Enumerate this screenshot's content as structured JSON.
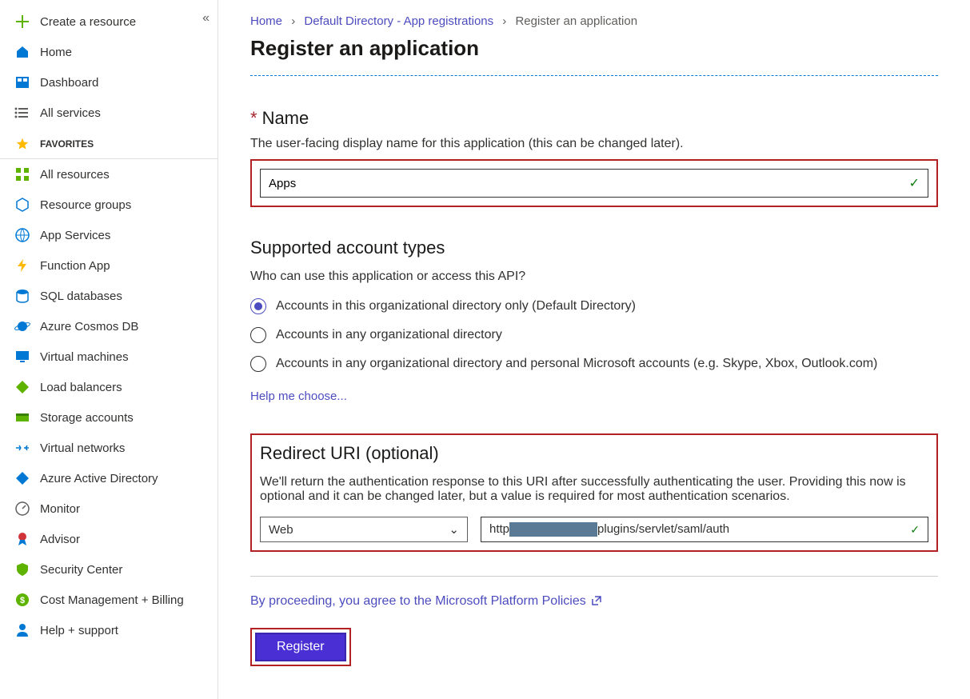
{
  "sidebar": {
    "create": "Create a resource",
    "home": "Home",
    "dashboard": "Dashboard",
    "all_services": "All services",
    "favorites_label": "FAVORITES",
    "items": [
      "All resources",
      "Resource groups",
      "App Services",
      "Function App",
      "SQL databases",
      "Azure Cosmos DB",
      "Virtual machines",
      "Load balancers",
      "Storage accounts",
      "Virtual networks",
      "Azure Active Directory",
      "Monitor",
      "Advisor",
      "Security Center",
      "Cost Management + Billing",
      "Help + support"
    ]
  },
  "breadcrumbs": {
    "home": "Home",
    "dir": "Default Directory - App registrations",
    "current": "Register an application"
  },
  "page_title": "Register an application",
  "name": {
    "label": "Name",
    "desc": "The user-facing display name for this application (this can be changed later).",
    "value": "Apps"
  },
  "account_types": {
    "title": "Supported account types",
    "desc": "Who can use this application or access this API?",
    "options": [
      "Accounts in this organizational directory only (Default Directory)",
      "Accounts in any organizational directory",
      "Accounts in any organizational directory and personal Microsoft accounts (e.g. Skype, Xbox, Outlook.com)"
    ],
    "help": "Help me choose..."
  },
  "redirect": {
    "title": "Redirect URI (optional)",
    "desc": "We'll return the authentication response to this URI after successfully authenticating the user. Providing this now is optional and it can be changed later, but a value is required for most authentication scenarios.",
    "type": "Web",
    "uri_prefix": "http",
    "uri_suffix": "plugins/servlet/saml/auth"
  },
  "policies": "By proceeding, you agree to the Microsoft Platform Policies",
  "register_label": "Register"
}
